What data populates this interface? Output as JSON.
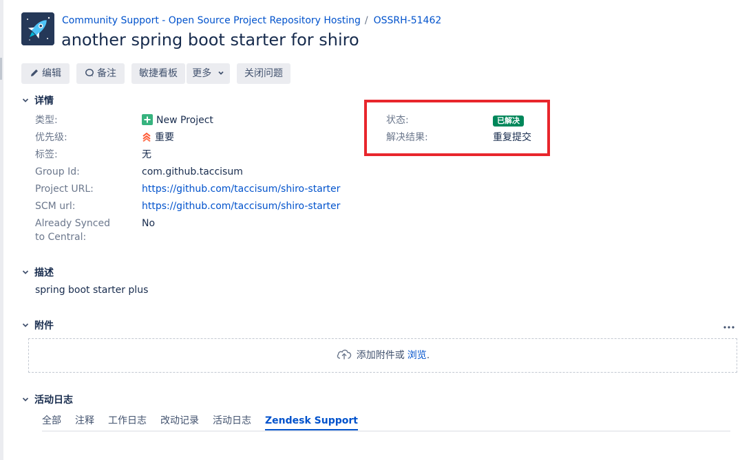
{
  "header": {
    "breadcrumb_project": "Community Support - Open Source Project Repository Hosting",
    "breadcrumb_sep": "/",
    "breadcrumb_issue_key": "OSSRH-51462",
    "title": "another spring boot starter for shiro",
    "avatar_icon": "rocket-icon"
  },
  "toolbar": {
    "edit": "编辑",
    "comment": "备注",
    "agile_board": "敏捷看板",
    "more": "更多",
    "close_issue": "关闭问题"
  },
  "details": {
    "section_title": "详情",
    "fields": [
      {
        "label": "类型:",
        "value": "New Project"
      },
      {
        "label": "优先级:",
        "value": "重要"
      },
      {
        "label": "标签:",
        "value": "无"
      },
      {
        "label": "Group Id:",
        "value": "com.github.taccisum"
      },
      {
        "label": "Project URL:",
        "value": "https://github.com/taccisum/shiro-starter"
      },
      {
        "label": "SCM url:",
        "value": "https://github.com/taccisum/shiro-starter"
      },
      {
        "label": "Already Synced to Central:",
        "value": "No"
      }
    ],
    "status_label": "状态:",
    "status_value": "已解决",
    "resolution_label": "解决结果:",
    "resolution_value": "重复提交"
  },
  "description": {
    "section_title": "描述",
    "text": "spring boot starter plus"
  },
  "attachments": {
    "section_title": "附件",
    "more": "•••",
    "drop_text": "添加附件或",
    "browse_link": "浏览",
    "drop_suffix": "."
  },
  "activity": {
    "section_title": "活动日志",
    "tabs": [
      "全部",
      "注释",
      "工作日志",
      "改动记录",
      "活动日志",
      "Zendesk Support"
    ],
    "active_tab": "Zendesk Support"
  },
  "colors": {
    "link": "#0052cc",
    "status_green": "#00875a",
    "highlight_red": "#e8262c",
    "priority_orange": "#ff5630",
    "type_green": "#36b37e"
  }
}
